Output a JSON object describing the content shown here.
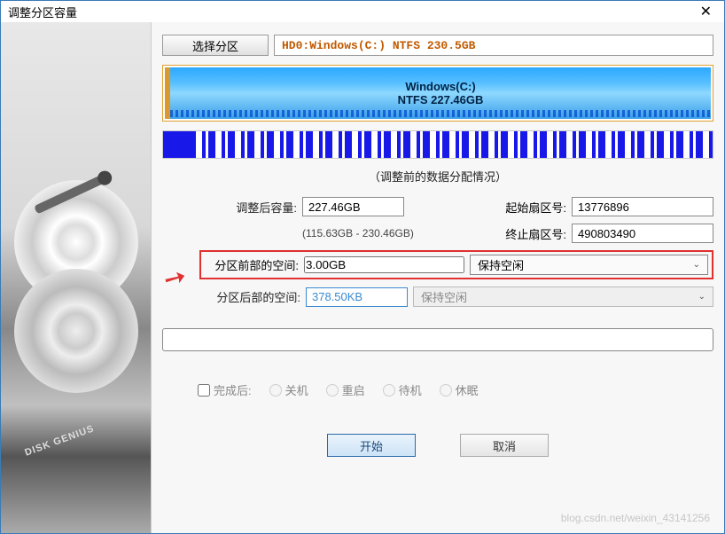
{
  "window": {
    "title": "调整分区容量"
  },
  "topbar": {
    "select_label": "选择分区",
    "partition_info": "HD0:Windows(C:) NTFS 230.5GB"
  },
  "diagram": {
    "name": "Windows(C:)",
    "fs_size": "NTFS 227.46GB"
  },
  "usage_caption": "（调整前的数据分配情况）",
  "form": {
    "after_size_label": "调整后容量:",
    "after_size_value": "227.46GB",
    "range_hint": "(115.63GB - 230.46GB)",
    "start_sector_label": "起始扇区号:",
    "start_sector_value": "13776896",
    "end_sector_label": "终止扇区号:",
    "end_sector_value": "490803490",
    "front_space_label": "分区前部的空间:",
    "front_space_value": "3.00GB",
    "front_space_option": "保持空闲",
    "back_space_label": "分区后部的空间:",
    "back_space_value": "378.50KB",
    "back_space_option": "保持空闲"
  },
  "post_action": {
    "label": "完成后:",
    "shutdown": "关机",
    "restart": "重启",
    "standby": "待机",
    "hibernate": "休眠"
  },
  "buttons": {
    "start": "开始",
    "cancel": "取消"
  },
  "sidebar_brand": "DISK GENIUS",
  "watermark": "blog.csdn.net/weixin_43141256"
}
